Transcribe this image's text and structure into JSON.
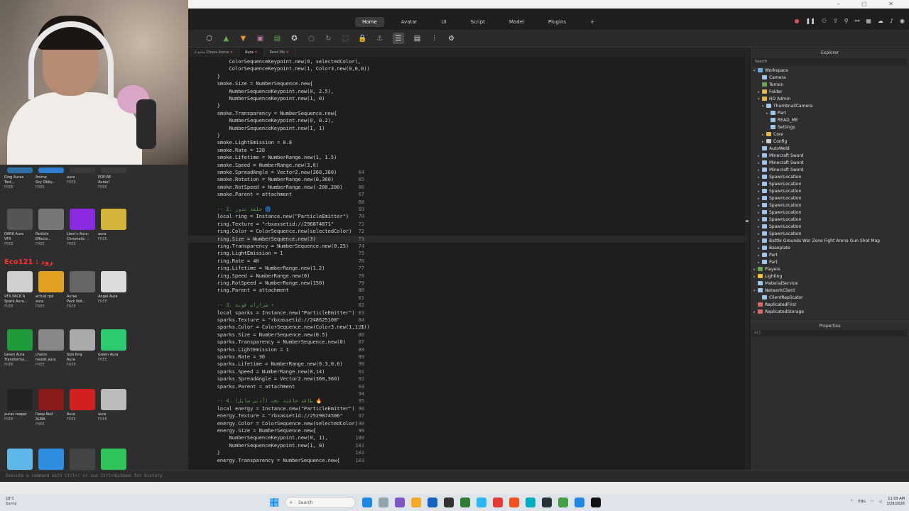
{
  "menubar": {
    "tabs": [
      "Home",
      "Avatar",
      "UI",
      "Script",
      "Model",
      "Plugins"
    ],
    "active": "Home"
  },
  "doc_tabs": [
    "ساحة لـ Chaos Arena",
    "Aura",
    "Read Me"
  ],
  "toolbox": {
    "items": [
      {
        "name": "Ring Auras",
        "sub": "Test...",
        "free": "FREE",
        "color": "#2d6ea8"
      },
      {
        "name": "Anime",
        "sub": "Sky Obby...",
        "free": "FREE",
        "color": "#2f7fcf"
      },
      {
        "name": "aura",
        "sub": "",
        "free": "FREE",
        "color": "#3a3a3a"
      },
      {
        "name": "POP:RE",
        "sub": "Auras!",
        "free": "FREE",
        "color": "#3a3a3a"
      },
      {
        "name": "DARK Aura",
        "sub": "VFX",
        "free": "FREE",
        "color": "#555"
      },
      {
        "name": "Particle",
        "sub": "Effects...",
        "free": "FREE",
        "color": "#777"
      },
      {
        "name": "Liem's Aura:",
        "sub": "Chromatic ...",
        "free": "FREE",
        "color": "#8a2be2"
      },
      {
        "name": "aura",
        "sub": "",
        "free": "FREE",
        "color": "#d4b43a"
      },
      {
        "name": "VFX PACK R",
        "sub": "Spark Aura...",
        "free": "FREE",
        "color": "#cfcfcf"
      },
      {
        "name": "actual rpd",
        "sub": "aura",
        "free": "FREE",
        "color": "#e0a020"
      },
      {
        "name": "Auras",
        "sub": "Pack Not...",
        "free": "FREE",
        "color": "#666"
      },
      {
        "name": "Angel Aura",
        "sub": "",
        "free": "FREE",
        "color": "#dcdcdc"
      },
      {
        "name": "Green Aura",
        "sub": "Transforma...",
        "free": "FREE",
        "color": "#1f9a3a"
      },
      {
        "name": "chains",
        "sub": "model aura",
        "free": "FREE",
        "color": "#888"
      },
      {
        "name": "Sols Rng",
        "sub": "Aura",
        "free": "FREE",
        "color": "#aaa"
      },
      {
        "name": "Green Aura",
        "sub": "",
        "free": "FREE",
        "color": "#2ecc71"
      },
      {
        "name": "auras reaper",
        "sub": "",
        "free": "FREE",
        "color": "#222"
      },
      {
        "name": "Deep Red",
        "sub": "AURA",
        "free": "FREE",
        "color": "#8b1a1a"
      },
      {
        "name": "Aura",
        "sub": "",
        "free": "FREE",
        "color": "#d21f1f"
      },
      {
        "name": "aura",
        "sub": "",
        "free": "FREE",
        "color": "#bbb"
      },
      {
        "name": "",
        "sub": "",
        "free": "",
        "color": "#5fb6e8"
      },
      {
        "name": "",
        "sub": "",
        "free": "",
        "color": "#2e8fe0"
      },
      {
        "name": "",
        "sub": "",
        "free": "",
        "color": "#444"
      },
      {
        "name": "",
        "sub": "",
        "free": "",
        "color": "#2ec45a"
      }
    ],
    "promo": "Eco121 : زود"
  },
  "code": {
    "lines": [
      {
        "n": "",
        "t": "            ColorSequenceKeypoint.new(0, selectedColor),",
        "c": ""
      },
      {
        "n": "",
        "t": "            ColorSequenceKeypoint.new(1, Color3.new(0,0,0))",
        "c": ""
      },
      {
        "n": "",
        "t": "        }",
        "c": ""
      },
      {
        "n": "",
        "t": "        smoke.Size = NumberSequence.new{",
        "c": ""
      },
      {
        "n": "",
        "t": "            NumberSequenceKeypoint.new(0, 2.5),",
        "c": ""
      },
      {
        "n": "",
        "t": "            NumberSequenceKeypoint.new(1, 0)",
        "c": ""
      },
      {
        "n": "",
        "t": "        }",
        "c": ""
      },
      {
        "n": "",
        "t": "        smoke.Transparency = NumberSequence.new{",
        "c": ""
      },
      {
        "n": "",
        "t": "            NumberSequenceKeypoint.new(0, 0.2),",
        "c": ""
      },
      {
        "n": "",
        "t": "            NumberSequenceKeypoint.new(1, 1)",
        "c": ""
      },
      {
        "n": "",
        "t": "        }",
        "c": ""
      },
      {
        "n": "",
        "t": "        smoke.LightEmission = 0.8",
        "c": ""
      },
      {
        "n": "",
        "t": "        smoke.Rate = 120",
        "c": ""
      },
      {
        "n": "",
        "t": "        smoke.Lifetime = NumberRange.new(1, 1.5)",
        "c": ""
      },
      {
        "n": "",
        "t": "        smoke.Speed = NumberRange.new(3,6)",
        "c": ""
      },
      {
        "n": "64",
        "t": "        smoke.SpreadAngle = Vector2.new(360,360)",
        "c": ""
      },
      {
        "n": "65",
        "t": "        smoke.Rotation = NumberRange.new(0,360)",
        "c": ""
      },
      {
        "n": "66",
        "t": "        smoke.RotSpeed = NumberRange.new(-200,200)",
        "c": ""
      },
      {
        "n": "67",
        "t": "        smoke.Parent = attachment",
        "c": ""
      },
      {
        "n": "68",
        "t": "",
        "c": ""
      },
      {
        "n": "69",
        "t": "        -- 2. حلقة تدور 🌀",
        "c": "comment"
      },
      {
        "n": "70",
        "t": "        local ring = Instance.new(\"ParticleEmitter\")",
        "c": ""
      },
      {
        "n": "71",
        "t": "        ring.Texture = \"rbxassetid://296874871\"",
        "c": ""
      },
      {
        "n": "72",
        "t": "        ring.Color = ColorSequence.new(selectedColor)",
        "c": ""
      },
      {
        "n": "73",
        "t": "        ring.Size = NumberSequence.new(3)",
        "c": "current"
      },
      {
        "n": "74",
        "t": "        ring.Transparency = NumberSequence.new(0.25)",
        "c": ""
      },
      {
        "n": "75",
        "t": "        ring.LightEmission = 1",
        "c": ""
      },
      {
        "n": "76",
        "t": "        ring.Rate = 40",
        "c": ""
      },
      {
        "n": "77",
        "t": "        ring.Lifetime = NumberRange.new(1.2)",
        "c": ""
      },
      {
        "n": "78",
        "t": "        ring.Speed = NumberRange.new(0)",
        "c": ""
      },
      {
        "n": "79",
        "t": "        ring.RotSpeed = NumberRange.new(150)",
        "c": ""
      },
      {
        "n": "80",
        "t": "        ring.Parent = attachment",
        "c": ""
      },
      {
        "n": "81",
        "t": "",
        "c": ""
      },
      {
        "n": "82",
        "t": "        -- 3. شرارات قوية ⚡",
        "c": "comment"
      },
      {
        "n": "83",
        "t": "        local sparks = Instance.new(\"ParticleEmitter\")",
        "c": ""
      },
      {
        "n": "84",
        "t": "        sparks.Texture = \"rbxassetid://248625108\"",
        "c": ""
      },
      {
        "n": "85",
        "t": "        sparks.Color = ColorSequence.new(Color3.new(1,1,1))",
        "c": ""
      },
      {
        "n": "86",
        "t": "        sparks.Size = NumberSequence.new(0.5)",
        "c": ""
      },
      {
        "n": "87",
        "t": "        sparks.Transparency = NumberSequence.new(0)",
        "c": ""
      },
      {
        "n": "88",
        "t": "        sparks.LightEmission = 1",
        "c": ""
      },
      {
        "n": "89",
        "t": "        sparks.Rate = 30",
        "c": ""
      },
      {
        "n": "90",
        "t": "        sparks.Lifetime = NumberRange.new(0.3,0.6)",
        "c": ""
      },
      {
        "n": "91",
        "t": "        sparks.Speed = NumberRange.new(8,14)",
        "c": ""
      },
      {
        "n": "92",
        "t": "        sparks.SpreadAngle = Vector2.new(360,360)",
        "c": ""
      },
      {
        "n": "93",
        "t": "        sparks.Parent = attachment",
        "c": ""
      },
      {
        "n": "94",
        "t": "",
        "c": ""
      },
      {
        "n": "95",
        "t": "        -- 4. طاقة خافتة تحت (أدنى سايل) 🔥",
        "c": "comment"
      },
      {
        "n": "96",
        "t": "        local energy = Instance.new(\"ParticleEmitter\")",
        "c": ""
      },
      {
        "n": "97",
        "t": "        energy.Texture = \"rbxassetid://2529074586\"",
        "c": ""
      },
      {
        "n": "98",
        "t": "        energy.Color = ColorSequence.new(selectedColor)",
        "c": ""
      },
      {
        "n": "99",
        "t": "        energy.Size = NumberSequence.new{",
        "c": "fold"
      },
      {
        "n": "100",
        "t": "            NumberSequenceKeypoint.new(0, 1),",
        "c": ""
      },
      {
        "n": "101",
        "t": "            NumberSequenceKeypoint.new(1, 0)",
        "c": ""
      },
      {
        "n": "102",
        "t": "        }",
        "c": ""
      },
      {
        "n": "103",
        "t": "        energy.Transparency = NumberSequence.new{",
        "c": "fold"
      }
    ]
  },
  "explorer": {
    "title": "Explorer",
    "search_placeholder": "Search",
    "rows": [
      {
        "label": "Workspace",
        "depth": 0,
        "arrow": "▾",
        "color": "#6fa8dc"
      },
      {
        "label": "Camera",
        "depth": 1,
        "arrow": "",
        "color": "#9fc5e8"
      },
      {
        "label": "Terrain",
        "depth": 1,
        "arrow": "",
        "color": "#6aa84f"
      },
      {
        "label": "Folder",
        "depth": 1,
        "arrow": "▸",
        "color": "#e6b84a"
      },
      {
        "label": "HD Admin",
        "depth": 1,
        "arrow": "▾",
        "color": "#e6b84a"
      },
      {
        "label": "ThumbnailCamera",
        "depth": 2,
        "arrow": "▾",
        "color": "#9fc5e8"
      },
      {
        "label": "Part",
        "depth": 3,
        "arrow": "▸",
        "color": "#9fc5e8"
      },
      {
        "label": "READ_ME",
        "depth": 3,
        "arrow": "",
        "color": "#9fc5e8"
      },
      {
        "label": "Settings",
        "depth": 3,
        "arrow": "",
        "color": "#9fc5e8"
      },
      {
        "label": "Core",
        "depth": 2,
        "arrow": "▸",
        "color": "#e6b84a"
      },
      {
        "label": "Config",
        "depth": 2,
        "arrow": "▸",
        "color": "#cccccc"
      },
      {
        "label": "AutoWeld",
        "depth": 1,
        "arrow": "",
        "color": "#9fc5e8"
      },
      {
        "label": "Minecraft Sword",
        "depth": 1,
        "arrow": "▸",
        "color": "#9fc5e8"
      },
      {
        "label": "Minecraft Sword",
        "depth": 1,
        "arrow": "▸",
        "color": "#9fc5e8"
      },
      {
        "label": "Minecraft Sword",
        "depth": 1,
        "arrow": "▸",
        "color": "#9fc5e8"
      },
      {
        "label": "SpawnLocation",
        "depth": 1,
        "arrow": "▸",
        "color": "#9fc5e8"
      },
      {
        "label": "SpawnLocation",
        "depth": 1,
        "arrow": "▸",
        "color": "#9fc5e8"
      },
      {
        "label": "SpawnLocation",
        "depth": 1,
        "arrow": "▸",
        "color": "#9fc5e8"
      },
      {
        "label": "SpawnLocation",
        "depth": 1,
        "arrow": "▸",
        "color": "#9fc5e8"
      },
      {
        "label": "SpawnLocation",
        "depth": 1,
        "arrow": "▸",
        "color": "#9fc5e8"
      },
      {
        "label": "SpawnLocation",
        "depth": 1,
        "arrow": "▸",
        "color": "#9fc5e8"
      },
      {
        "label": "SpawnLocation",
        "depth": 1,
        "arrow": "▸",
        "color": "#9fc5e8"
      },
      {
        "label": "SpawnLocation",
        "depth": 1,
        "arrow": "▸",
        "color": "#9fc5e8"
      },
      {
        "label": "SpawnLocation",
        "depth": 1,
        "arrow": "▸",
        "color": "#9fc5e8"
      },
      {
        "label": "Battle Grounds War Zone Fight Arena Gun Shot Map",
        "depth": 1,
        "arrow": "▸",
        "color": "#9fc5e8"
      },
      {
        "label": "Baseplate",
        "depth": 1,
        "arrow": "▸",
        "color": "#9fc5e8"
      },
      {
        "label": "Part",
        "depth": 1,
        "arrow": "▸",
        "color": "#9fc5e8"
      },
      {
        "label": "Part",
        "depth": 1,
        "arrow": "▸",
        "color": "#9fc5e8"
      },
      {
        "label": "Players",
        "depth": 0,
        "arrow": "▸",
        "color": "#6aa84f"
      },
      {
        "label": "Lighting",
        "depth": 0,
        "arrow": "▸",
        "color": "#f1c232"
      },
      {
        "label": "MaterialService",
        "depth": 0,
        "arrow": "",
        "color": "#9fc5e8"
      },
      {
        "label": "NetworkClient",
        "depth": 0,
        "arrow": "▾",
        "color": "#9fc5e8"
      },
      {
        "label": "ClientReplicator",
        "depth": 1,
        "arrow": "",
        "color": "#9fc5e8"
      },
      {
        "label": "ReplicatedFirst",
        "depth": 0,
        "arrow": "",
        "color": "#e06666"
      },
      {
        "label": "ReplicatedStorage",
        "depth": 0,
        "arrow": "▸",
        "color": "#e06666"
      }
    ]
  },
  "properties": {
    "title": "Properties",
    "filter_placeholder": "${}"
  },
  "command_bar": {
    "placeholder": "Execute a command with Ctrl+/ or use Ctrl+Up/Down for history"
  },
  "taskbar": {
    "weather_temp": "18°C",
    "weather_text": "Sunny",
    "search_label": "Search",
    "lang": "ENG",
    "time": "11:03 AM",
    "date": "3/28/2026"
  }
}
